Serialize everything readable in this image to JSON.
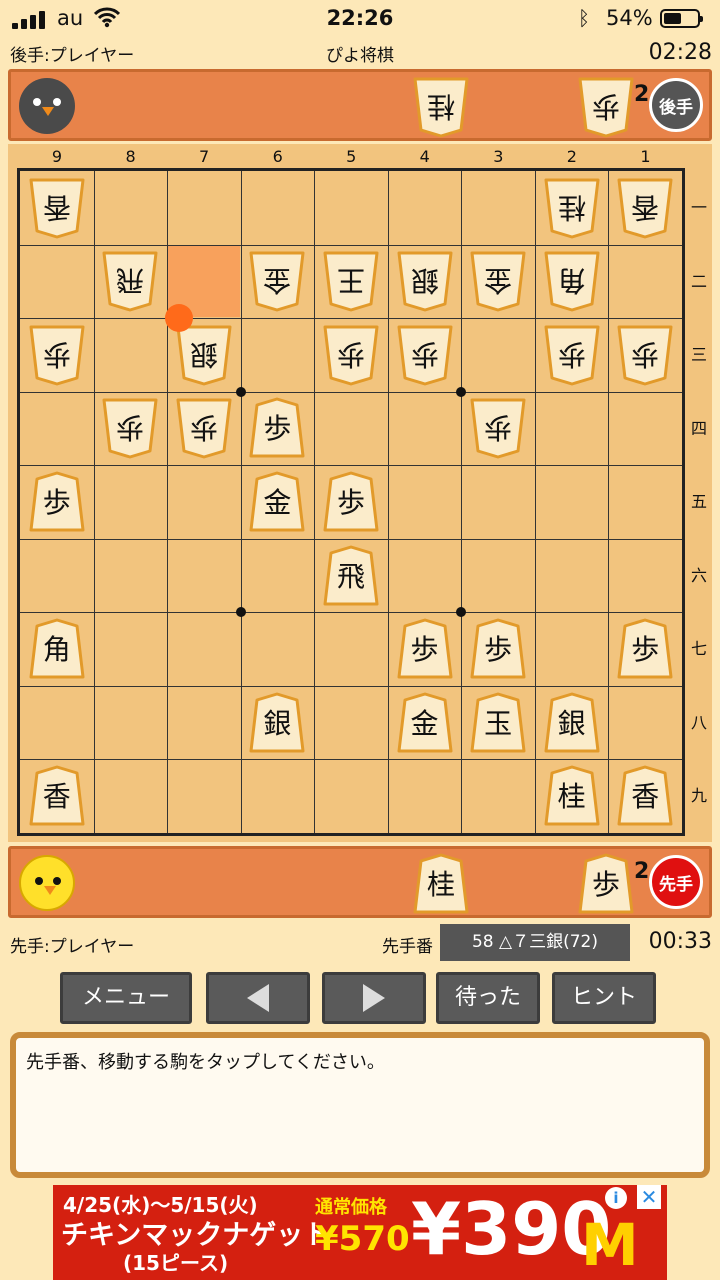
{
  "status_bar": {
    "carrier": "au",
    "time": "22:26",
    "battery": "54%",
    "battery_level": 0.54,
    "bluetooth_icon": "bluetooth-icon",
    "wifi_icon": "wifi-icon"
  },
  "header": {
    "gote_name": "後手:プレイヤー",
    "title": "ぴよ将棋",
    "gote_time": "02:28"
  },
  "gote_hand": {
    "badge": "後手",
    "pieces": [
      {
        "label": "桂",
        "count": ""
      },
      {
        "label": "歩",
        "count": "2"
      }
    ]
  },
  "sente_hand": {
    "badge": "先手",
    "pieces": [
      {
        "label": "桂",
        "count": ""
      },
      {
        "label": "歩",
        "count": "2"
      }
    ]
  },
  "board": {
    "files": [
      "9",
      "8",
      "7",
      "6",
      "5",
      "4",
      "3",
      "2",
      "1"
    ],
    "ranks": [
      "一",
      "二",
      "三",
      "四",
      "五",
      "六",
      "七",
      "八",
      "九"
    ],
    "last_move_square": {
      "file": 7,
      "rank": 2
    },
    "pieces": [
      {
        "file": 9,
        "rank": 1,
        "label": "香",
        "owner": "gote"
      },
      {
        "file": 2,
        "rank": 1,
        "label": "桂",
        "owner": "gote"
      },
      {
        "file": 1,
        "rank": 1,
        "label": "香",
        "owner": "gote"
      },
      {
        "file": 8,
        "rank": 2,
        "label": "飛",
        "owner": "gote"
      },
      {
        "file": 6,
        "rank": 2,
        "label": "金",
        "owner": "gote"
      },
      {
        "file": 5,
        "rank": 2,
        "label": "王",
        "owner": "gote"
      },
      {
        "file": 4,
        "rank": 2,
        "label": "銀",
        "owner": "gote"
      },
      {
        "file": 3,
        "rank": 2,
        "label": "金",
        "owner": "gote"
      },
      {
        "file": 2,
        "rank": 2,
        "label": "角",
        "owner": "gote"
      },
      {
        "file": 9,
        "rank": 3,
        "label": "歩",
        "owner": "gote"
      },
      {
        "file": 7,
        "rank": 3,
        "label": "銀",
        "owner": "gote"
      },
      {
        "file": 5,
        "rank": 3,
        "label": "歩",
        "owner": "gote"
      },
      {
        "file": 4,
        "rank": 3,
        "label": "歩",
        "owner": "gote"
      },
      {
        "file": 2,
        "rank": 3,
        "label": "歩",
        "owner": "gote"
      },
      {
        "file": 1,
        "rank": 3,
        "label": "歩",
        "owner": "gote"
      },
      {
        "file": 8,
        "rank": 4,
        "label": "歩",
        "owner": "gote"
      },
      {
        "file": 7,
        "rank": 4,
        "label": "歩",
        "owner": "gote"
      },
      {
        "file": 6,
        "rank": 4,
        "label": "歩",
        "owner": "sente"
      },
      {
        "file": 3,
        "rank": 4,
        "label": "歩",
        "owner": "gote"
      },
      {
        "file": 9,
        "rank": 5,
        "label": "歩",
        "owner": "sente"
      },
      {
        "file": 6,
        "rank": 5,
        "label": "金",
        "owner": "sente"
      },
      {
        "file": 5,
        "rank": 5,
        "label": "歩",
        "owner": "sente"
      },
      {
        "file": 5,
        "rank": 6,
        "label": "飛",
        "owner": "sente"
      },
      {
        "file": 9,
        "rank": 7,
        "label": "角",
        "owner": "sente"
      },
      {
        "file": 4,
        "rank": 7,
        "label": "歩",
        "owner": "sente"
      },
      {
        "file": 3,
        "rank": 7,
        "label": "歩",
        "owner": "sente"
      },
      {
        "file": 1,
        "rank": 7,
        "label": "歩",
        "owner": "sente"
      },
      {
        "file": 6,
        "rank": 8,
        "label": "銀",
        "owner": "sente"
      },
      {
        "file": 4,
        "rank": 8,
        "label": "金",
        "owner": "sente"
      },
      {
        "file": 3,
        "rank": 8,
        "label": "玉",
        "owner": "sente"
      },
      {
        "file": 2,
        "rank": 8,
        "label": "銀",
        "owner": "sente"
      },
      {
        "file": 9,
        "rank": 9,
        "label": "香",
        "owner": "sente"
      },
      {
        "file": 2,
        "rank": 9,
        "label": "桂",
        "owner": "sente"
      },
      {
        "file": 1,
        "rank": 9,
        "label": "香",
        "owner": "sente"
      }
    ]
  },
  "footer_info": {
    "sente_name": "先手:プレイヤー",
    "turn": "先手番",
    "last_move": "58 △７三銀(72)",
    "sente_time": "00:33"
  },
  "buttons": {
    "menu": "メニュー",
    "back_icon": "prev-arrow-icon",
    "forward_icon": "next-arrow-icon",
    "undo": "待った",
    "hint": "ヒント"
  },
  "message": "先手番、移動する駒をタップしてください。",
  "ad": {
    "date": "4/25(水)～5/15(火)",
    "product": "チキンマックナゲット",
    "count": "(15ピース)",
    "regular_label": "通常価格",
    "regular_price": "¥570",
    "price": "¥390",
    "logo": "M",
    "info_icon": "i",
    "close_icon": "✕"
  }
}
